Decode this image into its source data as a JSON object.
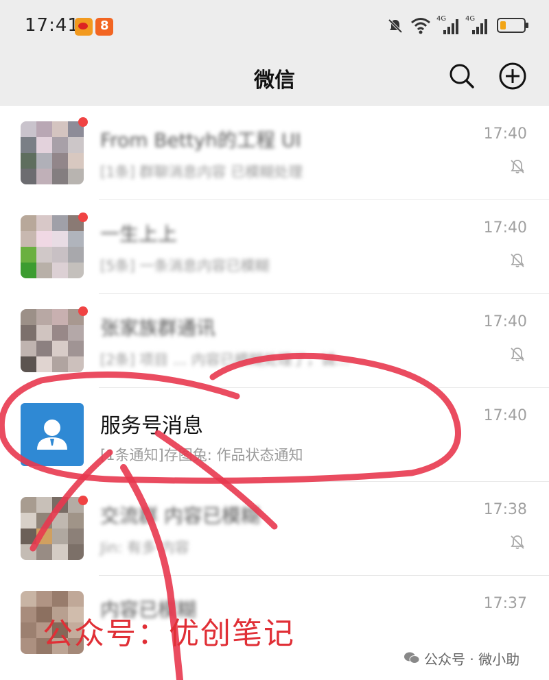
{
  "status": {
    "time": "17:41",
    "net1": "4G",
    "net2": "4G"
  },
  "header": {
    "title": "微信"
  },
  "chats": [
    {
      "name": "From Bettyh的工程 UI",
      "preview": "[1条] 群聊消息内容 已模糊处理",
      "time": "17:40"
    },
    {
      "name": "一生上上",
      "preview": "[5条] 一条消息内容已模糊",
      "time": "17:40"
    },
    {
      "name": "张家族群通讯",
      "preview": "[2条] 项目 ... 内容已模糊处理了，诚…",
      "time": "17:40"
    },
    {
      "name": "服务号消息",
      "preview": "[1条通知]存图兔: 作品状态通知",
      "time": "17:40"
    },
    {
      "name": "交流群 内容已模糊",
      "preview": "Jin: 有多 内容",
      "time": "17:38"
    },
    {
      "name": "内容已模糊",
      "preview": "",
      "time": "17:37"
    }
  ],
  "watermark": {
    "main": "公众号：优创笔记",
    "corner": "公众号 · 微小助"
  },
  "colors": {
    "service_avatar": "#2f89d4",
    "unread_dot": "#f04343",
    "annotation": "#e8384f"
  }
}
